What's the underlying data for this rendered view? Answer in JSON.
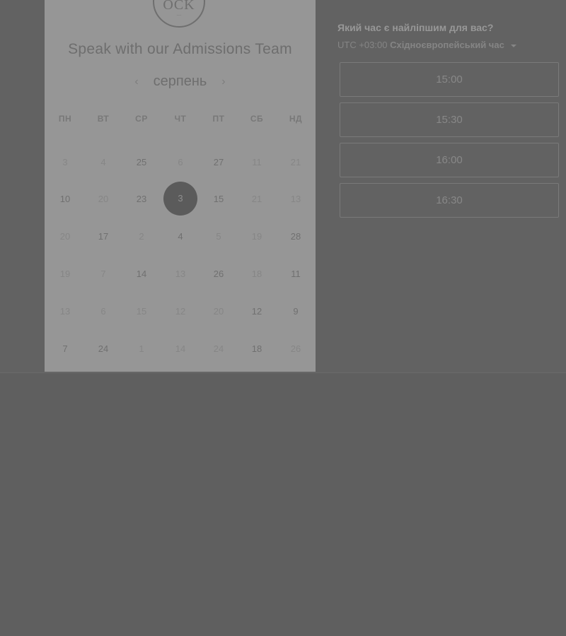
{
  "logo": {
    "main": "OCK",
    "sub": "...."
  },
  "calendar": {
    "title": "Speak with our Admissions Team",
    "month": "серпень",
    "prev_icon": "‹",
    "next_icon": "›",
    "weekdays": [
      "ПН",
      "ВТ",
      "СР",
      "ЧТ",
      "ПТ",
      "СБ",
      "НД"
    ],
    "weeks": [
      [
        "3",
        "4",
        "25",
        "6",
        "27",
        "11",
        "21"
      ],
      [
        "10",
        "20",
        "23",
        "3",
        "15",
        "21",
        "13"
      ],
      [
        "20",
        "17",
        "2",
        "4",
        "5",
        "19",
        "28"
      ],
      [
        "19",
        "7",
        "14",
        "13",
        "26",
        "18",
        "11"
      ],
      [
        "13",
        "6",
        "15",
        "12",
        "20",
        "12",
        "9"
      ],
      [
        "7",
        "24",
        "1",
        "14",
        "24",
        "18",
        "26"
      ]
    ],
    "selected_day": "3"
  },
  "times": {
    "heading": "Який час є найліпшим для вас?",
    "tz_offset": "UTC +03:00",
    "tz_name": "Східноєвропейський час",
    "slots": [
      "15:00",
      "15:30",
      "16:00",
      "16:30"
    ]
  },
  "colors": {
    "panel": "#969696",
    "background": "#626262",
    "selected_day": "#5b5b5b"
  }
}
